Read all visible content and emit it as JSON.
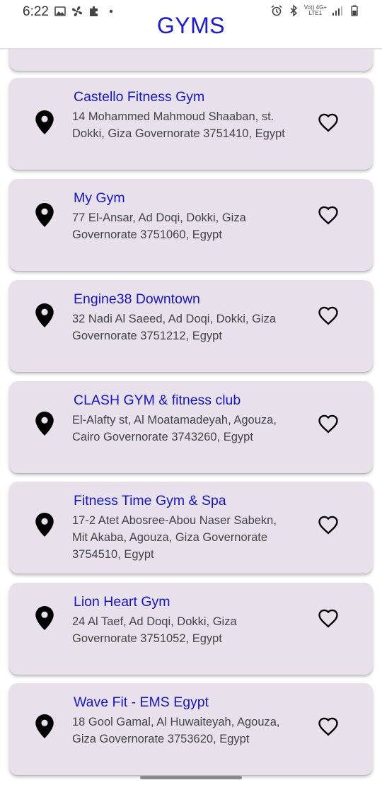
{
  "status_bar": {
    "time": "6:22",
    "net_top": "Vo)) 4G+",
    "net_bottom": "LTE1"
  },
  "header": {
    "title": "GYMS"
  },
  "gyms": [
    {
      "name": "Castello Fitness Gym",
      "address": "14 Mohammed Mahmoud Shaaban, st. Dokki, Giza Governorate 3751410, Egypt"
    },
    {
      "name": "My Gym",
      "address": "77 El-Ansar, Ad Doqi, Dokki, Giza Governorate 3751060, Egypt"
    },
    {
      "name": "Engine38 Downtown",
      "address": "32 Nadi Al Saeed, Ad Doqi, Dokki, Giza Governorate 3751212, Egypt"
    },
    {
      "name": "CLASH GYM & fitness club",
      "address": "El-Alafty st, Al Moatamadeyah, Agouza, Cairo Governorate 3743260, Egypt"
    },
    {
      "name": "Fitness Time Gym & Spa",
      "address": "17-2 Atet Abosree-Abou Naser Sabekn, Mit Akaba, Agouza, Giza Governorate 3754510, Egypt"
    },
    {
      "name": "Lion Heart Gym",
      "address": "24 Al Taef, Ad Doqi, Dokki, Giza Governorate 3751052, Egypt"
    },
    {
      "name": "Wave Fit - EMS Egypt",
      "address": "18 Gool Gamal, Al Huwaiteyah, Agouza, Giza Governorate 3753620, Egypt"
    }
  ],
  "icons": {
    "location": "map-pin-icon",
    "favorite": "heart-outline-icon"
  },
  "colors": {
    "title": "#1a1ad8",
    "card_background": "#e8e1ec",
    "gym_name": "#1515cc"
  }
}
